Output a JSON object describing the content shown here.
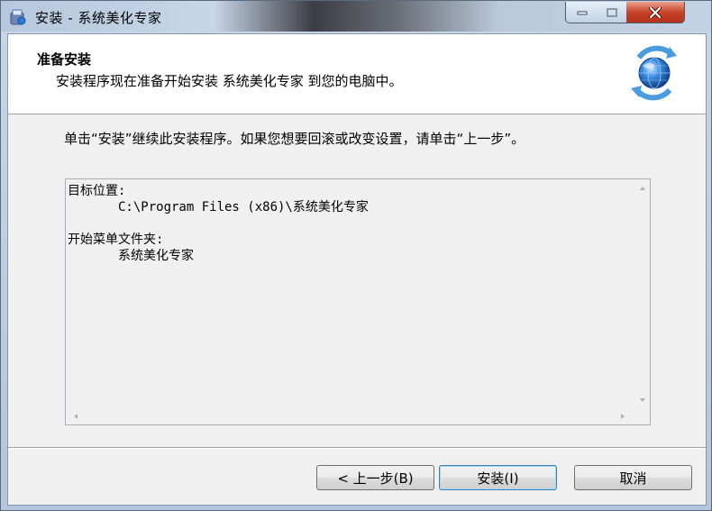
{
  "window": {
    "title": "安装 - 系统美化专家"
  },
  "header": {
    "title": "准备安装",
    "subtitle": "安装程序现在准备开始安装 系统美化专家 到您的电脑中。"
  },
  "intro": {
    "text": "单击“安装”继续此安装程序。如果您想要回滚或改变设置，请单击“上一步”。"
  },
  "memo": {
    "dest_label": "目标位置:",
    "dest_value": "C:\\Program Files (x86)\\系统美化专家",
    "menu_label": "开始菜单文件夹:",
    "menu_value": "系统美化专家"
  },
  "buttons": {
    "back": "< 上一步(B)",
    "install": "安装(I)",
    "cancel": "取消"
  },
  "colors": {
    "close_button": "#c8432a",
    "default_button_border": "#3c7fb1"
  },
  "icons": {
    "app": "installer-app-icon",
    "logo": "globe-refresh-icon"
  }
}
